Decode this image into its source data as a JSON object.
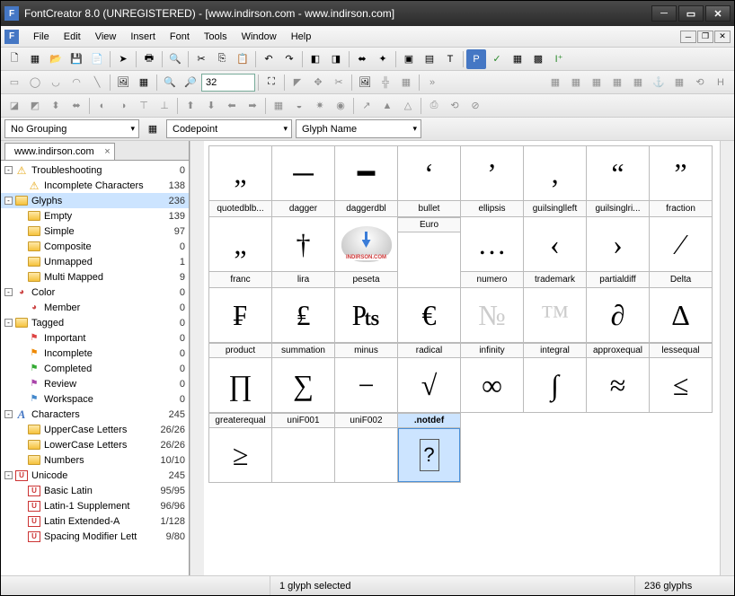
{
  "window": {
    "title": "FontCreator 8.0 (UNREGISTERED) - [www.indirson.com - www.indirson.com]"
  },
  "menu": {
    "items": [
      "File",
      "Edit",
      "View",
      "Insert",
      "Font",
      "Tools",
      "Window",
      "Help"
    ]
  },
  "toolbar2": {
    "zoom_value": "32"
  },
  "filters": {
    "grouping": "No Grouping",
    "sort": "Codepoint",
    "name": "Glyph Name"
  },
  "tab": {
    "label": "www.indirson.com"
  },
  "tree": [
    {
      "indent": 0,
      "toggle": "-",
      "icon": "warn",
      "label": "Troubleshooting",
      "count": "0"
    },
    {
      "indent": 1,
      "toggle": "",
      "icon": "warn",
      "label": "Incomplete Characters",
      "count": "138"
    },
    {
      "indent": 0,
      "toggle": "-",
      "icon": "folder",
      "label": "Glyphs",
      "count": "236",
      "selected": true
    },
    {
      "indent": 1,
      "toggle": "",
      "icon": "folder",
      "label": "Empty",
      "count": "139"
    },
    {
      "indent": 1,
      "toggle": "",
      "icon": "folder",
      "label": "Simple",
      "count": "97"
    },
    {
      "indent": 1,
      "toggle": "",
      "icon": "folder",
      "label": "Composite",
      "count": "0"
    },
    {
      "indent": 1,
      "toggle": "",
      "icon": "folder",
      "label": "Unmapped",
      "count": "1"
    },
    {
      "indent": 1,
      "toggle": "",
      "icon": "folder",
      "label": "Multi Mapped",
      "count": "9"
    },
    {
      "indent": 0,
      "toggle": "-",
      "icon": "color",
      "label": "Color",
      "count": "0"
    },
    {
      "indent": 1,
      "toggle": "",
      "icon": "color",
      "label": "Member",
      "count": "0"
    },
    {
      "indent": 0,
      "toggle": "-",
      "icon": "folder",
      "label": "Tagged",
      "count": "0"
    },
    {
      "indent": 1,
      "toggle": "",
      "icon": "flag-r",
      "label": "Important",
      "count": "0"
    },
    {
      "indent": 1,
      "toggle": "",
      "icon": "flag-o",
      "label": "Incomplete",
      "count": "0"
    },
    {
      "indent": 1,
      "toggle": "",
      "icon": "flag-g",
      "label": "Completed",
      "count": "0"
    },
    {
      "indent": 1,
      "toggle": "",
      "icon": "flag-p",
      "label": "Review",
      "count": "0"
    },
    {
      "indent": 1,
      "toggle": "",
      "icon": "flag-b",
      "label": "Workspace",
      "count": "0"
    },
    {
      "indent": 0,
      "toggle": "-",
      "icon": "char",
      "label": "Characters",
      "count": "245"
    },
    {
      "indent": 1,
      "toggle": "",
      "icon": "folder",
      "label": "UpperCase Letters",
      "count": "26/26"
    },
    {
      "indent": 1,
      "toggle": "",
      "icon": "folder",
      "label": "LowerCase Letters",
      "count": "26/26"
    },
    {
      "indent": 1,
      "toggle": "",
      "icon": "folder",
      "label": "Numbers",
      "count": "10/10"
    },
    {
      "indent": 0,
      "toggle": "-",
      "icon": "uni",
      "label": "Unicode",
      "count": "245"
    },
    {
      "indent": 1,
      "toggle": "",
      "icon": "uni",
      "label": "Basic Latin",
      "count": "95/95"
    },
    {
      "indent": 1,
      "toggle": "",
      "icon": "uni",
      "label": "Latin-1 Supplement",
      "count": "96/96"
    },
    {
      "indent": 1,
      "toggle": "",
      "icon": "uni",
      "label": "Latin Extended-A",
      "count": "1/128"
    },
    {
      "indent": 1,
      "toggle": "",
      "icon": "uni",
      "label": "Spacing Modifier Lett",
      "count": "9/80"
    }
  ],
  "glyphs": [
    {
      "name": "quotedblb...",
      "char": "„"
    },
    {
      "name": "dagger",
      "char": "─"
    },
    {
      "name": "daggerdbl",
      "char": "━"
    },
    {
      "name": "bullet",
      "char": "‘"
    },
    {
      "name": "ellipsis",
      "char": "’"
    },
    {
      "name": "guilsinglleft",
      "char": "‚"
    },
    {
      "name": "guilsinglri...",
      "char": "“"
    },
    {
      "name": "fraction",
      "char": "”"
    },
    {
      "name": "franc",
      "char": "„"
    },
    {
      "name": "lira",
      "char": "†"
    },
    {
      "name": "peseta",
      "char": "☁",
      "logo": true
    },
    {
      "name": "Euro",
      "char": ""
    },
    {
      "name": "numero",
      "char": "…"
    },
    {
      "name": "trademark",
      "char": "‹"
    },
    {
      "name": "partialdiff",
      "char": "›"
    },
    {
      "name": "Delta",
      "char": "⁄"
    },
    {
      "name": "",
      "char": "₣"
    },
    {
      "name": "",
      "char": "₤"
    },
    {
      "name": "",
      "char": "₧"
    },
    {
      "name": "",
      "char": "€"
    },
    {
      "name": "",
      "char": "№",
      "grey": true
    },
    {
      "name": "",
      "char": "™",
      "grey": true
    },
    {
      "name": "",
      "char": "∂"
    },
    {
      "name": "",
      "char": "Δ"
    },
    {
      "name": "product",
      "char": ""
    },
    {
      "name": "summation",
      "char": ""
    },
    {
      "name": "minus",
      "char": ""
    },
    {
      "name": "radical",
      "char": ""
    },
    {
      "name": "infinity",
      "char": ""
    },
    {
      "name": "integral",
      "char": ""
    },
    {
      "name": "approxequal",
      "char": ""
    },
    {
      "name": "lessequal",
      "char": ""
    },
    {
      "name": "",
      "char": "∏"
    },
    {
      "name": "",
      "char": "∑"
    },
    {
      "name": "",
      "char": "−"
    },
    {
      "name": "",
      "char": "√"
    },
    {
      "name": "",
      "char": "∞"
    },
    {
      "name": "",
      "char": "∫"
    },
    {
      "name": "",
      "char": "≈"
    },
    {
      "name": "",
      "char": "≤"
    },
    {
      "name": "greaterequal",
      "char": ""
    },
    {
      "name": "uniF001",
      "char": ""
    },
    {
      "name": "uniF002",
      "char": ""
    },
    {
      "name": ".notdef",
      "char": "",
      "selected": true
    },
    {
      "name": "",
      "char": "",
      "blank": true
    },
    {
      "name": "",
      "char": "",
      "blank": true
    },
    {
      "name": "",
      "char": "",
      "blank": true
    },
    {
      "name": "",
      "char": "",
      "blank": true
    },
    {
      "name": "",
      "char": "≥"
    },
    {
      "name": "",
      "char": ""
    },
    {
      "name": "",
      "char": ""
    },
    {
      "name": "",
      "char": "?",
      "notdef": true,
      "previewSelected": true
    },
    {
      "name": "",
      "char": "",
      "blank": true
    },
    {
      "name": "",
      "char": "",
      "blank": true
    },
    {
      "name": "",
      "char": "",
      "blank": true
    },
    {
      "name": "",
      "char": "",
      "blank": true
    }
  ],
  "status": {
    "selection": "1 glyph selected",
    "total": "236 glyphs"
  }
}
